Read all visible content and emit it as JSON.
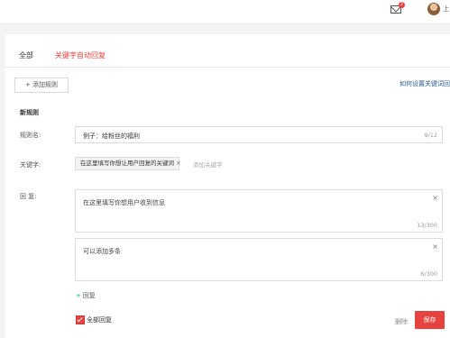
{
  "header": {
    "mail_badge": "2",
    "user_initial": "上"
  },
  "tabs": [
    {
      "label": "全部"
    },
    {
      "label": "关键字自动回复"
    }
  ],
  "toolbar": {
    "add_rule_label": "+ 添加规则",
    "howto_label": "如何设置关键词回"
  },
  "form": {
    "section_title": "新规则",
    "rule_name_label": "规则名:",
    "rule_name_value": "例子：给粉丝的福利",
    "rule_name_counter": "9/12",
    "keyword_label": "关键字:",
    "keyword_tag": "在这里填写你想让用户回复的关键词",
    "keyword_close": "×",
    "keyword_add_label": "添加关键字",
    "reply_label": "回 复:",
    "replies": [
      {
        "text": "在这里填写你想用户收到信息",
        "counter": "13/300",
        "close": "×"
      },
      {
        "text": "可以添加多条",
        "counter": "6/300",
        "close": "×"
      }
    ],
    "add_reply_plus": "+",
    "add_reply_label": "回复",
    "reply_all_label": "全部回复",
    "reply_all_checked": true,
    "delete_label": "删除",
    "save_label": "保存"
  },
  "colors": {
    "accent": "#e64340",
    "link": "#2c5d95"
  }
}
